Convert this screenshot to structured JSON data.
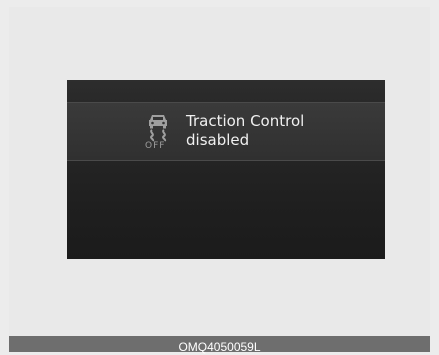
{
  "display": {
    "message_line1": "Traction Control",
    "message_line2": "disabled",
    "icon": "traction-control-off-icon",
    "icon_status_label": "OFF"
  },
  "caption": {
    "code": "OMQ4050059L"
  },
  "colors": {
    "screen_background": "#262626",
    "message_text": "#f0f0f0",
    "icon_gray": "#9c9c9c",
    "page_background": "#ececec",
    "caption_bar": "#6e6e6e"
  }
}
